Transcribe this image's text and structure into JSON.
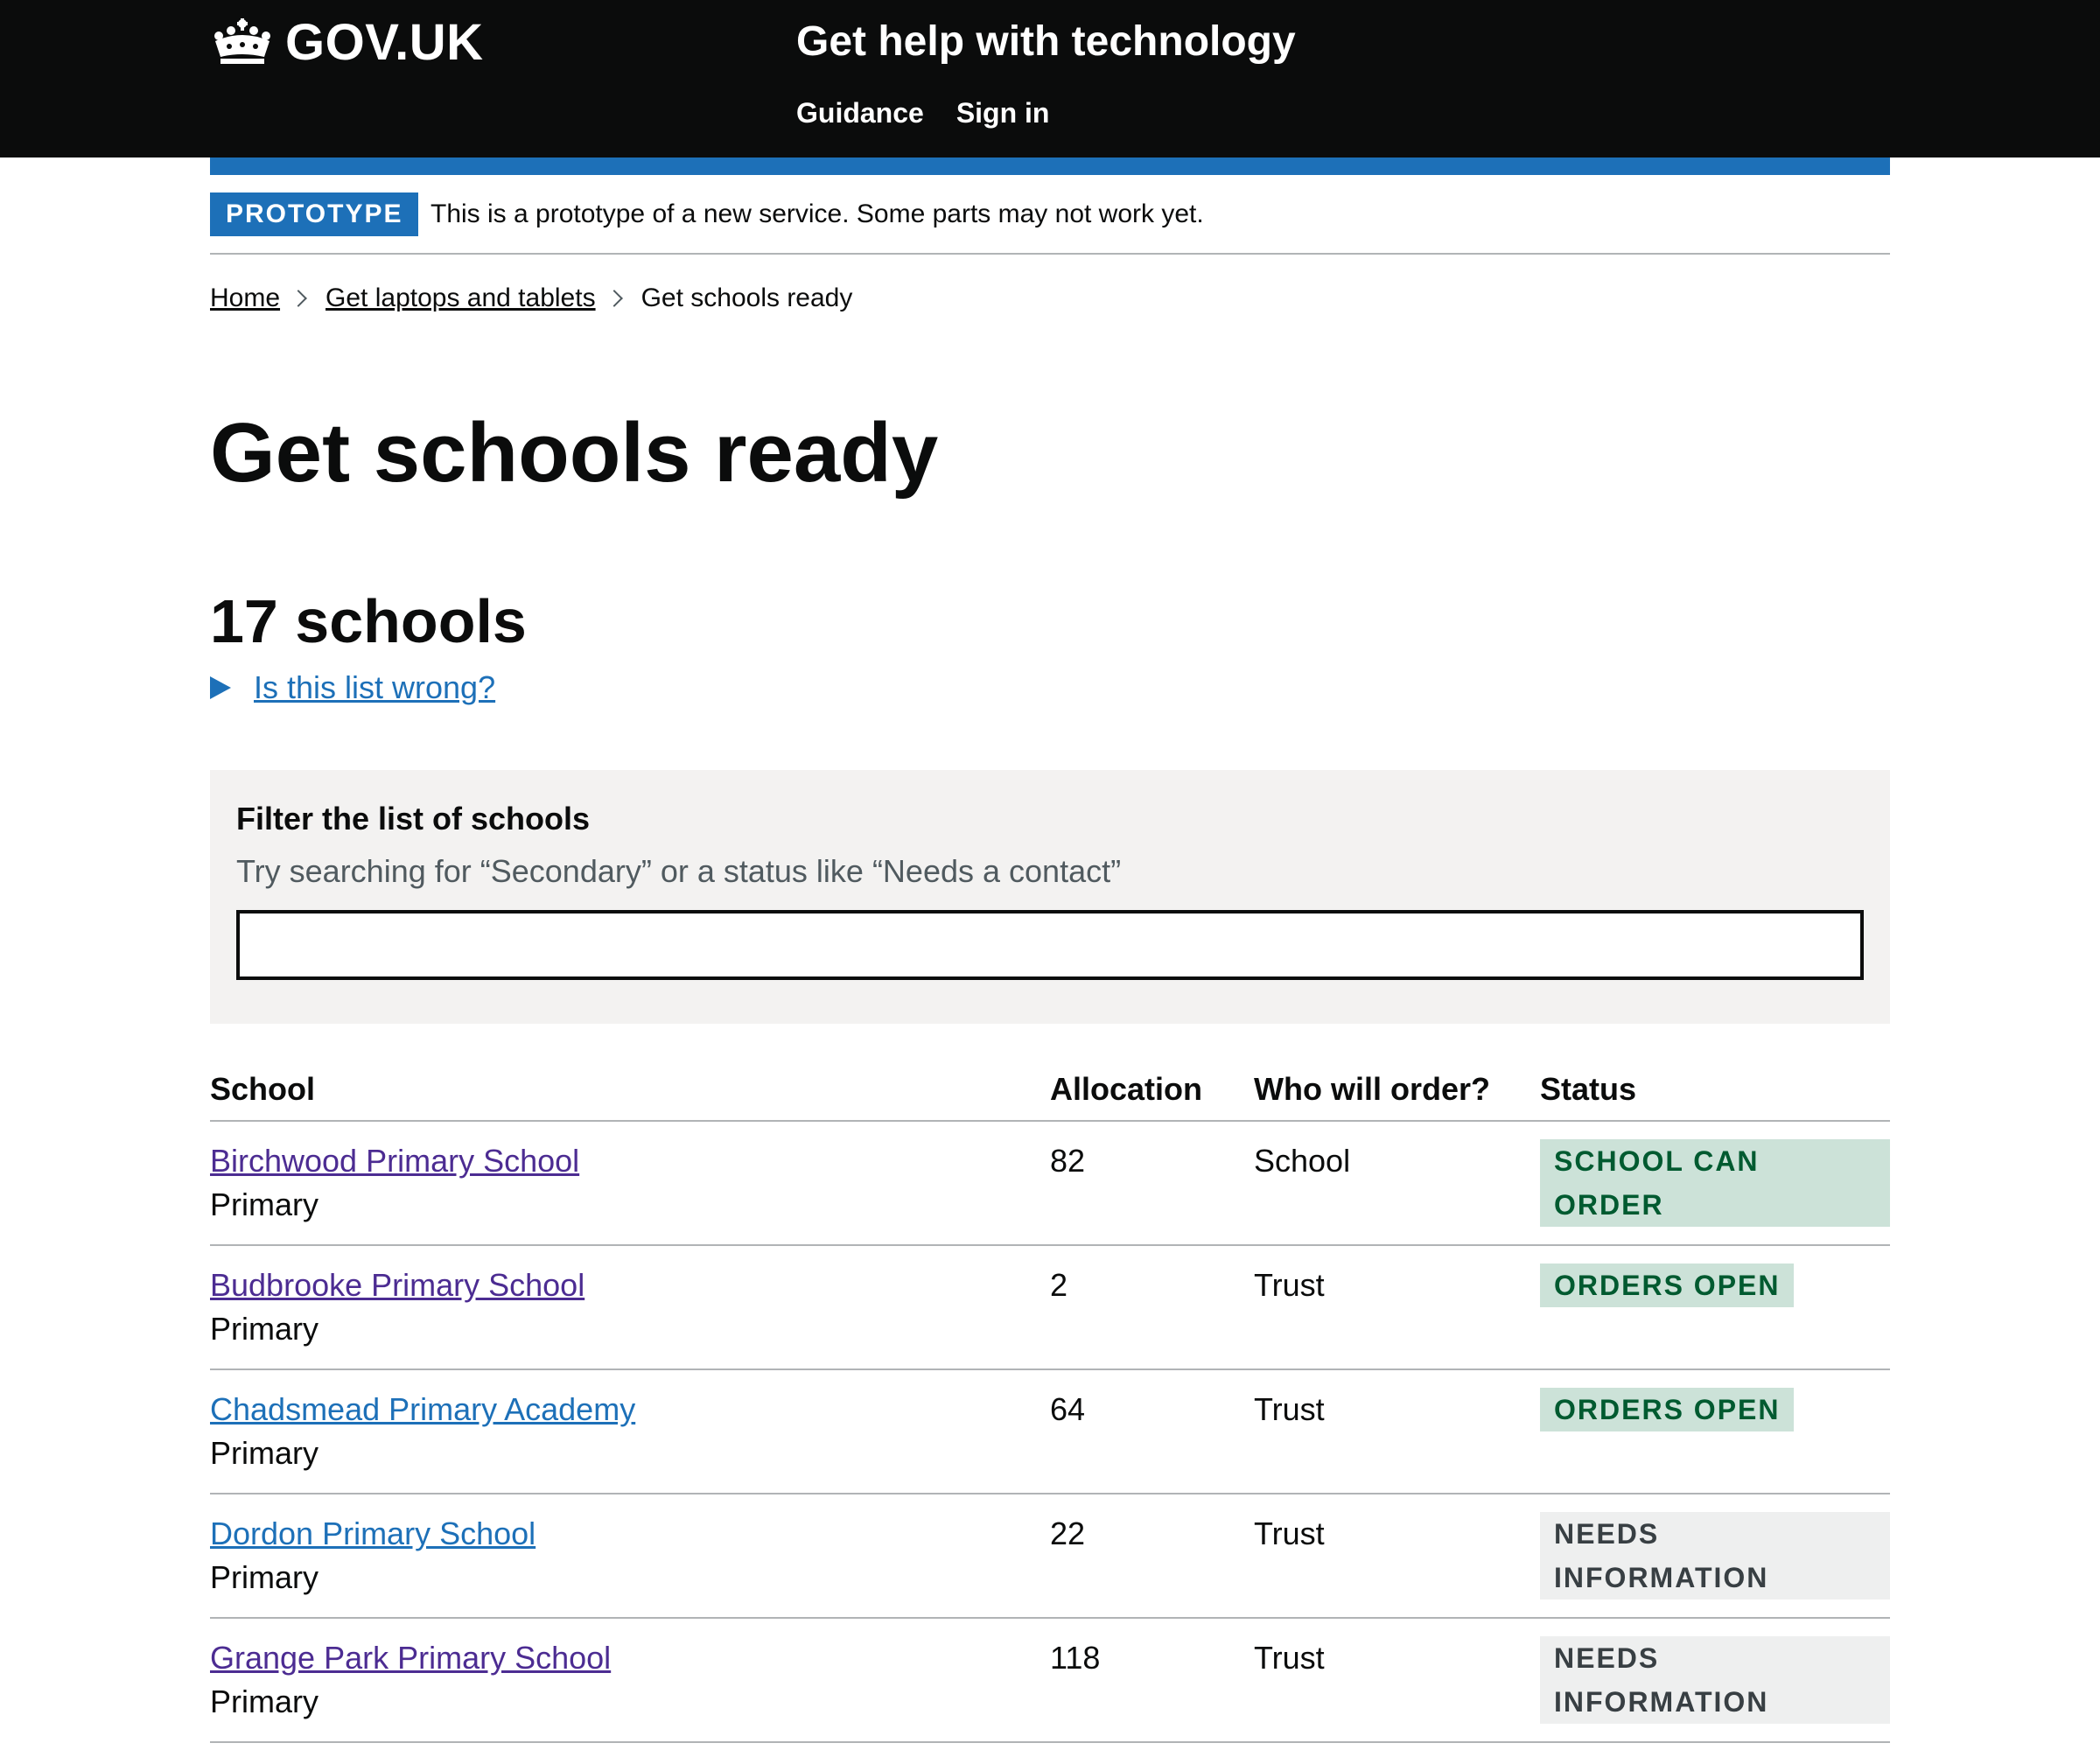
{
  "header": {
    "logo_text": "GOV.UK",
    "service_name": "Get help with technology",
    "nav": [
      "Guidance",
      "Sign in"
    ]
  },
  "phase_banner": {
    "tag": "PROTOTYPE",
    "text": "This is a prototype of a new service. Some parts may not work yet."
  },
  "breadcrumbs": [
    "Home",
    "Get laptops and tablets",
    "Get schools ready"
  ],
  "page_title": "Get schools ready",
  "count_heading": "17 schools",
  "details_summary": "Is this list wrong?",
  "filter": {
    "label": "Filter the list of schools",
    "hint": "Try searching for “Secondary” or a status like “Needs a contact”",
    "value": ""
  },
  "table": {
    "headers": [
      "School",
      "Allocation",
      "Who will order?",
      "Status"
    ],
    "rows": [
      {
        "name": "Birchwood Primary School",
        "type": "Primary",
        "allocation": "82",
        "who": "School",
        "status": "SCHOOL CAN ORDER",
        "status_color": "green"
      },
      {
        "name": "Budbrooke Primary School",
        "type": "Primary",
        "allocation": "2",
        "who": "Trust",
        "status": "ORDERS OPEN",
        "status_color": "green"
      },
      {
        "name": "Chadsmead Primary Academy",
        "type": "Primary",
        "allocation": "64",
        "who": "Trust",
        "status": "ORDERS OPEN",
        "status_color": "green"
      },
      {
        "name": "Dordon Primary School",
        "type": "Primary",
        "allocation": "22",
        "who": "Trust",
        "status": "NEEDS INFORMATION",
        "status_color": "grey"
      },
      {
        "name": "Grange Park Primary School",
        "type": "Primary",
        "allocation": "118",
        "who": "Trust",
        "status": "NEEDS INFORMATION",
        "status_color": "grey"
      }
    ]
  },
  "colors": {
    "header_bg": "#0b0c0c",
    "brand_blue": "#1d70b8",
    "visited_link": "#4c2c92",
    "tag_green_bg": "#cce2d8",
    "tag_green_text": "#005a30",
    "tag_grey_bg": "#eeefef",
    "tag_grey_text": "#383f43"
  }
}
